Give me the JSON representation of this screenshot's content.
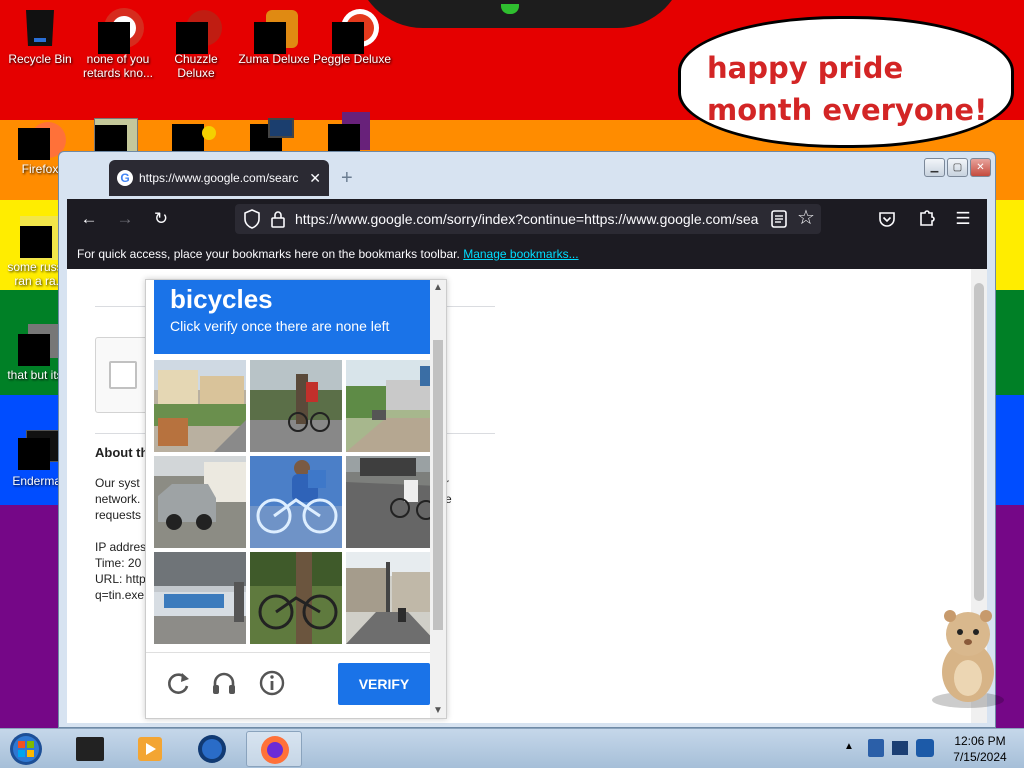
{
  "desktop": {
    "icons": [
      {
        "label": "Recycle Bin",
        "icon": "recycle-bin-icon"
      },
      {
        "label": "none of you retards kno...",
        "icon": "redacted-icon"
      },
      {
        "label": "Chuzzle Deluxe",
        "icon": "chuzzle-icon"
      },
      {
        "label": "Zuma Deluxe",
        "icon": "zuma-icon"
      },
      {
        "label": "Peggle Deluxe",
        "icon": "peggle-icon"
      },
      {
        "label": "Firefox",
        "icon": "firefox-icon"
      },
      {
        "label": "some russ... ran a ra...",
        "icon": "redacted-icon"
      },
      {
        "label": "that but its...",
        "icon": "redacted-icon"
      },
      {
        "label": "Enderman",
        "icon": "redacted-icon"
      }
    ],
    "speech_bubble": "happy pride month everyone!"
  },
  "browser": {
    "tab_title": "https://www.google.com/searc",
    "url": "https://www.google.com/sorry/index?continue=https://www.google.com/sea",
    "bookmarks_hint": "For quick access, place your bookmarks here on the bookmarks toolbar.",
    "bookmarks_link": "Manage bookmarks...",
    "page": {
      "about_heading": "About th",
      "body_lines": [
        "Our syst",
        "network.",
        "requests"
      ],
      "body_right": [
        "r",
        "e"
      ],
      "ip_lines": [
        "IP addres",
        "Time: 20",
        "URL: http",
        "q=tin.exe"
      ]
    }
  },
  "captcha": {
    "heading": "bicycles",
    "instruction": "Click verify once there are none left",
    "verify_label": "VERIFY",
    "tiles": [
      "street-houses-tile",
      "cyclist-red-tile",
      "roadside-shop-tile",
      "parked-car-tile",
      "cyclist-blue-tile",
      "cyclist-road-tile",
      "overpass-tile",
      "bicycle-tree-tile",
      "town-street-tile"
    ]
  },
  "taskbar": {
    "time": "12:06 PM",
    "date": "7/15/2024"
  },
  "colors": {
    "captcha_blue": "#1a73e8",
    "browser_dark": "#1c1b22",
    "bubble_text": "#d32525"
  }
}
